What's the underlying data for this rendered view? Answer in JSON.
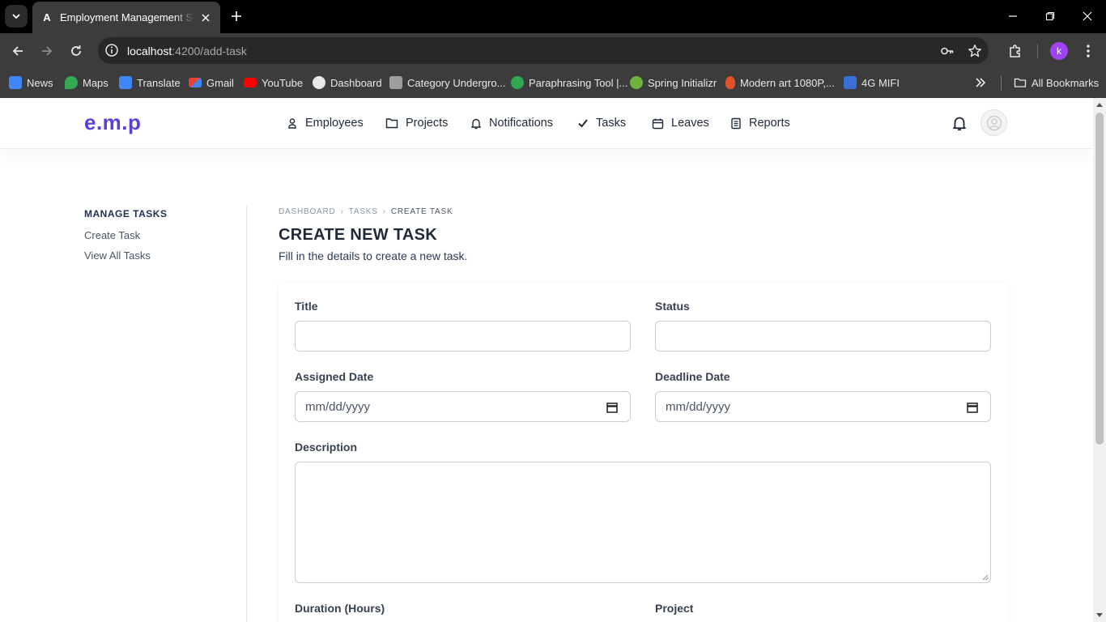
{
  "browser": {
    "tab_title": "Employment Management System",
    "tab_favicon": "A",
    "url_host": "localhost",
    "url_path": ":4200/add-task",
    "profile_initial": "k",
    "bookmarks": [
      {
        "label": "News",
        "icon_color": "#4285f4"
      },
      {
        "label": "Maps",
        "icon_color": "#34a853"
      },
      {
        "label": "Translate",
        "icon_color": "#4285f4"
      },
      {
        "label": "Gmail",
        "icon_color": "#ea4335"
      },
      {
        "label": "YouTube",
        "icon_color": "#ff0000"
      },
      {
        "label": "Dashboard",
        "icon_color": "#e8e8e8"
      },
      {
        "label": "Category Undergro...",
        "icon_color": "#9e9e9e"
      },
      {
        "label": "Paraphrasing Tool |...",
        "icon_color": "#2fa84f"
      },
      {
        "label": "Spring Initializr",
        "icon_color": "#6db33f"
      },
      {
        "label": "Modern art 1080P,...",
        "icon_color": "#e0522c"
      },
      {
        "label": "4G MIFI",
        "icon_color": "#3b6fd8"
      }
    ],
    "all_bookmarks": "All Bookmarks"
  },
  "app": {
    "logo": "e.m.p",
    "brand_color": "#5a3fd8",
    "nav": [
      {
        "label": "Employees",
        "icon": "user-icon"
      },
      {
        "label": "Projects",
        "icon": "folder-icon"
      },
      {
        "label": "Notifications",
        "icon": "bell-icon"
      },
      {
        "label": "Tasks",
        "icon": "check-icon"
      },
      {
        "label": "Leaves",
        "icon": "calendar-icon"
      },
      {
        "label": "Reports",
        "icon": "document-icon"
      }
    ]
  },
  "sidebar": {
    "title": "MANAGE TASKS",
    "links": [
      "Create Task",
      "View All Tasks"
    ]
  },
  "breadcrumb": [
    "DASHBOARD",
    "TASKS",
    "CREATE TASK"
  ],
  "page": {
    "title": "CREATE NEW TASK",
    "subtitle": "Fill in the details to create a new task."
  },
  "form": {
    "title_label": "Title",
    "title_value": "",
    "status_label": "Status",
    "status_value": "",
    "assigned_date_label": "Assigned Date",
    "assigned_date_placeholder": "mm/dd/yyyy",
    "deadline_date_label": "Deadline Date",
    "deadline_date_placeholder": "mm/dd/yyyy",
    "description_label": "Description",
    "description_value": "",
    "duration_label": "Duration (Hours)",
    "project_label": "Project"
  }
}
